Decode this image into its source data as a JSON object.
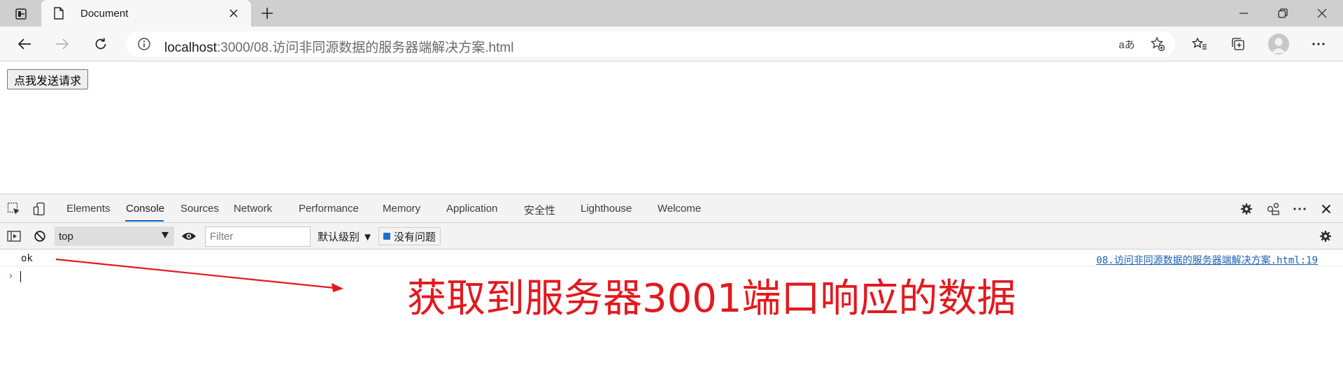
{
  "browser": {
    "tab_title": "Document",
    "url_host": "localhost",
    "url_path": ":3000/08.访问非同源数据的服务器端解决方案.html",
    "read_aloud_label": "aあ"
  },
  "page": {
    "send_button_label": "点我发送请求"
  },
  "devtools": {
    "tabs": [
      "Elements",
      "Console",
      "Sources",
      "Network",
      "Performance",
      "Memory",
      "Application",
      "安全性",
      "Lighthouse",
      "Welcome"
    ],
    "active_tab": "Console",
    "context_selector": "top",
    "filter_placeholder": "Filter",
    "levels_label": "默认级别 ▼",
    "issues_label": "没有问题"
  },
  "console": {
    "log_message": "ok",
    "log_source": "08.访问非同源数据的服务器端解决方案.html:19",
    "prompt_symbol": "›"
  },
  "annotation": {
    "text": "获取到服务器3001端口响应的数据",
    "color": "#e3191e"
  }
}
